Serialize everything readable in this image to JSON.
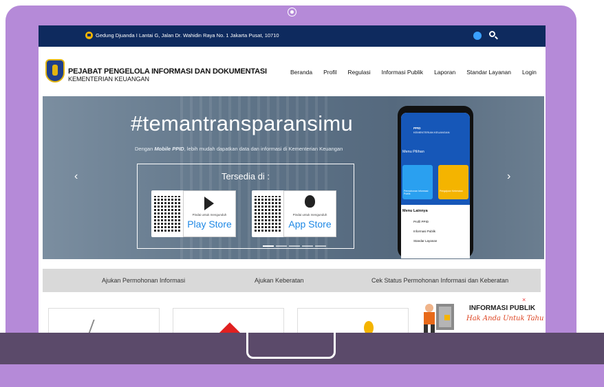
{
  "topbar": {
    "address": "Gedung Djuanda I Lantai G, Jalan Dr. Wahidin Raya No. 1 Jakarta Pusat, 10710"
  },
  "header": {
    "title": "PEJABAT PENGELOLA INFORMASI DAN DOKUMENTASI",
    "subtitle": "KEMENTERIAN KEUANGAN",
    "nav": [
      "Beranda",
      "Profil",
      "Regulasi",
      "Informasi Publik",
      "Laporan",
      "Standar Layanan",
      "Login"
    ]
  },
  "hero": {
    "hashtag": "#temantransparansimu",
    "tagline_prefix": "Dengan ",
    "tagline_app": "Mobile PPID",
    "tagline_suffix": ", lebih mudah dapatkan data dan informasi di Kementerian Keuangan",
    "available": "Tersedia di :",
    "stores": [
      {
        "small": "Pindai untuk mengunduh",
        "name": "Play Store"
      },
      {
        "small": "Pindai untuk mengunduh",
        "name": "App Store"
      }
    ],
    "prev": "‹",
    "next": "›"
  },
  "phone": {
    "brand": "PPID",
    "brand_sub": "KEMENTERIAN KEUANGAN",
    "menu_pilihan": "Menu Pilihan",
    "tiles": [
      "Permohonan Informasi Publik",
      "Pengajuan Keberatan"
    ],
    "menu_lainnya": "Menu Lainnya",
    "items": [
      "Profil PPID",
      "Informasi Publik",
      "Standar Layanan"
    ]
  },
  "actions": [
    "Ajukan Permohonan Informasi",
    "Ajukan Keberatan",
    "Cek Status Permohonan Informasi dan Keberatan"
  ],
  "popup": {
    "close": "×",
    "title": "INFORMASI PUBLIK",
    "subtitle": "Hak Anda Untuk Tahu !"
  },
  "colors": {
    "topbar": "#0e2a5e",
    "laptop_frame": "#b58ad8",
    "laptop_base": "#5b4a6a",
    "store_text": "#1e88e5"
  }
}
